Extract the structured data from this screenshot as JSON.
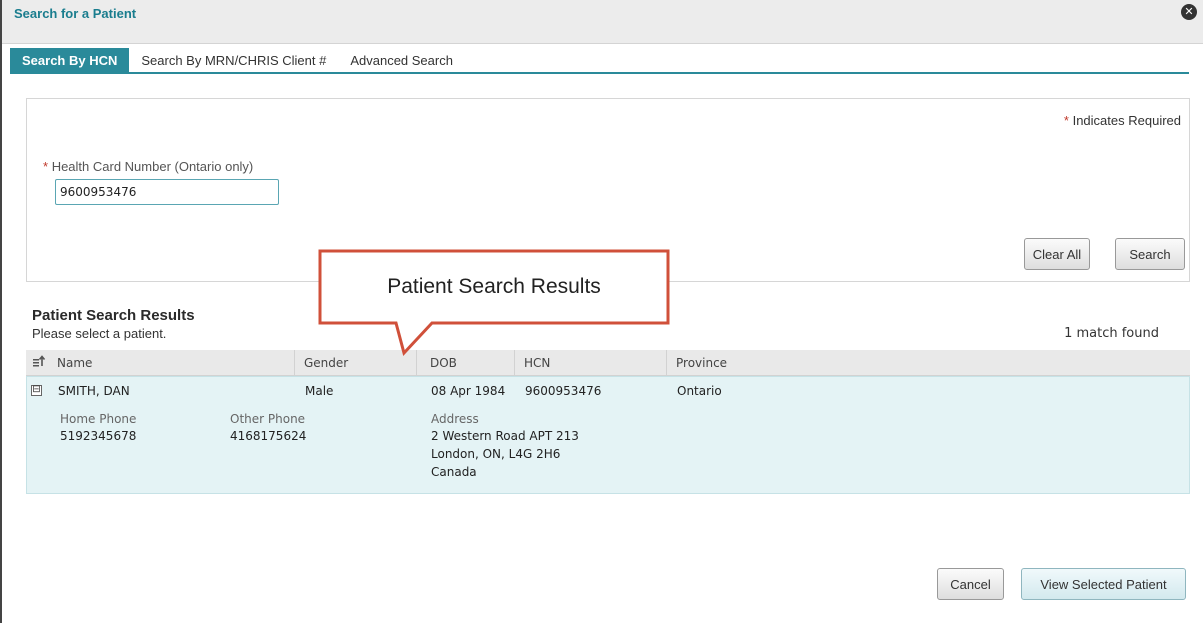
{
  "dialog": {
    "title": "Search for a Patient",
    "close_icon": "close-icon"
  },
  "tabs": [
    {
      "label": "Search By HCN",
      "active": true
    },
    {
      "label": "Search By MRN/CHRIS Client #",
      "active": false
    },
    {
      "label": "Advanced Search",
      "active": false
    }
  ],
  "form": {
    "required_note_star": "*",
    "required_note": "Indicates Required",
    "hcn_label_star": "*",
    "hcn_label": "Health Card Number (Ontario only)",
    "hcn_value": "9600953476",
    "clear_label": "Clear All",
    "search_label": "Search"
  },
  "results": {
    "title": "Patient Search Results",
    "subtitle": "Please select a patient.",
    "match_count": "1 match found",
    "columns": [
      "Name",
      "Gender",
      "DOB",
      "HCN",
      "Province"
    ],
    "sort_icon": "sort-icon",
    "rows": [
      {
        "expander": "⊟",
        "name": "SMITH, DAN",
        "gender": "Male",
        "dob": "08 Apr 1984",
        "hcn": "9600953476",
        "province": "Ontario",
        "home_phone_label": "Home Phone",
        "home_phone": "5192345678",
        "other_phone_label": "Other Phone",
        "other_phone": "4168175624",
        "address_label": "Address",
        "address_line1": "2 Western Road APT 213",
        "address_line2": "London, ON, L4G 2H6",
        "address_line3": "Canada"
      }
    ]
  },
  "callout": {
    "text": "Patient Search Results",
    "color": "#d0503a"
  },
  "footer": {
    "cancel_label": "Cancel",
    "view_label": "View Selected Patient"
  },
  "colors": {
    "accent": "#2a8a9a",
    "title_text": "#1a7d8e",
    "selected_row": "#e4f3f5",
    "required_star": "#c0392b"
  }
}
